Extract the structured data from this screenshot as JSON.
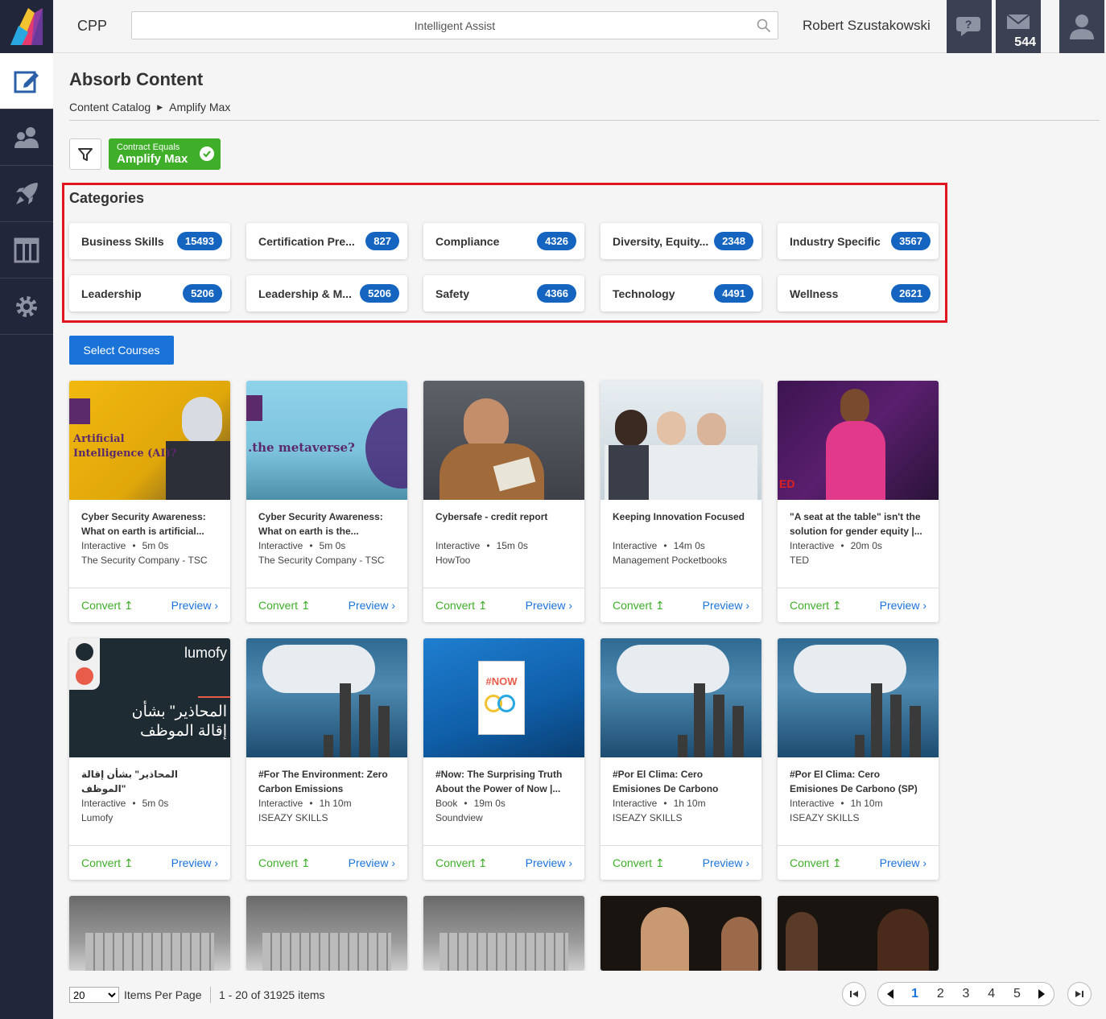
{
  "topbar": {
    "brand": "CPP",
    "search_placeholder": "Intelligent Assist",
    "username": "Robert Szustakowski",
    "messages_count": "544"
  },
  "page": {
    "title": "Absorb Content",
    "breadcrumb": [
      "Content Catalog",
      "Amplify Max"
    ]
  },
  "filter": {
    "label": "Contract Equals",
    "value": "Amplify Max"
  },
  "categories": {
    "title": "Categories",
    "items": [
      {
        "name": "Business Skills",
        "count": "15493"
      },
      {
        "name": "Certification Pre...",
        "count": "827"
      },
      {
        "name": "Compliance",
        "count": "4326"
      },
      {
        "name": "Diversity, Equity...",
        "count": "2348"
      },
      {
        "name": "Industry Specific",
        "count": "3567"
      },
      {
        "name": "Leadership",
        "count": "5206"
      },
      {
        "name": "Leadership & M...",
        "count": "5206"
      },
      {
        "name": "Safety",
        "count": "4366"
      },
      {
        "name": "Technology",
        "count": "4491"
      },
      {
        "name": "Wellness",
        "count": "2621"
      }
    ]
  },
  "select_courses_label": "Select Courses",
  "courses": [
    {
      "title": "Cyber Security Awareness: What on earth is artificial...",
      "type": "Interactive",
      "duration": "5m 0s",
      "provider": "The Security Company - TSC",
      "thumb_text": "Artificial Intelligence (AI)?"
    },
    {
      "title": "Cyber Security Awareness: What on earth is the...",
      "type": "Interactive",
      "duration": "5m 0s",
      "provider": "The Security Company - TSC",
      "thumb_text": ".the metaverse?"
    },
    {
      "title": "Cybersafe - credit report",
      "type": "Interactive",
      "duration": "15m 0s",
      "provider": "HowToo",
      "thumb_text": ""
    },
    {
      "title": "Keeping Innovation Focused",
      "type": "Interactive",
      "duration": "14m 0s",
      "provider": "Management Pocketbooks",
      "thumb_text": ""
    },
    {
      "title": "\"A seat at the table\" isn't the solution for gender equity |...",
      "type": "Interactive",
      "duration": "20m 0s",
      "provider": "TED",
      "thumb_text": ""
    },
    {
      "title": "المحاذير\" بشأن إقالة الموظف\"",
      "type": "Interactive",
      "duration": "5m 0s",
      "provider": "Lumofy",
      "thumb_text": "المحاذير\" بشأن إقالة الموظف"
    },
    {
      "title": "#For The Environment: Zero Carbon Emissions",
      "type": "Interactive",
      "duration": "1h 10m",
      "provider": "ISEAZY SKILLS",
      "thumb_text": ""
    },
    {
      "title": "#Now: The Surprising Truth About the Power of Now |...",
      "type": "Book",
      "duration": "19m 0s",
      "provider": "Soundview",
      "thumb_text": "#NOW"
    },
    {
      "title": "#Por El Clima: Cero Emisiones De Carbono",
      "type": "Interactive",
      "duration": "1h 10m",
      "provider": "ISEAZY SKILLS",
      "thumb_text": ""
    },
    {
      "title": "#Por El Clima: Cero Emisiones De Carbono (SP)",
      "type": "Interactive",
      "duration": "1h 10m",
      "provider": "ISEAZY SKILLS",
      "thumb_text": ""
    }
  ],
  "card_actions": {
    "convert": "Convert",
    "preview": "Preview"
  },
  "thumb_brand": "lumofy",
  "pagination": {
    "per_page": "20",
    "per_page_label": "Items Per Page",
    "range": "1 - 20 of 31925 items",
    "pages": [
      "1",
      "2",
      "3",
      "4",
      "5"
    ],
    "current": "1"
  },
  "colors": {
    "accent": "#1a73d9",
    "green": "#3fae29",
    "badge": "#1565c0",
    "highlight": "#e0161e",
    "nav": "#22263a"
  }
}
